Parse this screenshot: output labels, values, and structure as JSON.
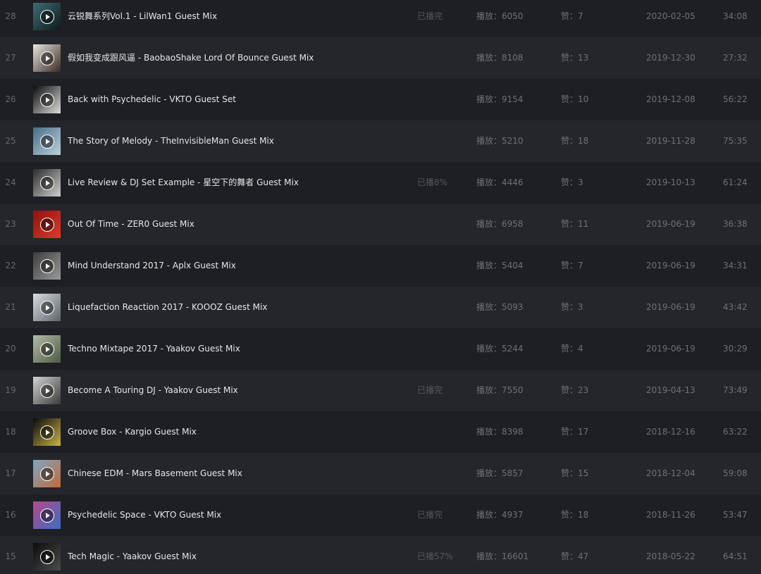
{
  "labels": {
    "plays_prefix": "播放：",
    "likes_prefix": "赞："
  },
  "tracks": [
    {
      "num": "28",
      "title": "云锐舞系列Vol.1 - LilWan1 Guest Mix",
      "progress": "已播完",
      "plays": "6050",
      "likes": "7",
      "date": "2020-02-05",
      "duration": "34:08",
      "cover": "#3f6d75",
      "cover2": "#0e1a1d"
    },
    {
      "num": "27",
      "title": "假如我变成跟风逼 - BaobaoShake Lord Of Bounce Guest Mix",
      "progress": "",
      "plays": "8108",
      "likes": "13",
      "date": "2019-12-30",
      "duration": "27:32",
      "cover": "#e9e6e1",
      "cover2": "#3a2a22"
    },
    {
      "num": "26",
      "title": "Back with Psychedelic - VKTO Guest Set",
      "progress": "",
      "plays": "9154",
      "likes": "10",
      "date": "2019-12-08",
      "duration": "56:22",
      "cover": "#0b0b0b",
      "cover2": "#dcdcdc"
    },
    {
      "num": "25",
      "title": "The Story of Melody - TheInvisibleMan Guest Mix",
      "progress": "",
      "plays": "5210",
      "likes": "18",
      "date": "2019-11-28",
      "duration": "75:35",
      "cover": "#4a6e86",
      "cover2": "#bcd0dd"
    },
    {
      "num": "24",
      "title": "Live Review & DJ Set Example - 星空下的舞者 Guest Mix",
      "progress": "已播8%",
      "plays": "4446",
      "likes": "3",
      "date": "2019-10-13",
      "duration": "61:24",
      "cover": "#2b2b2b",
      "cover2": "#cfcfcf"
    },
    {
      "num": "23",
      "title": "Out Of Time - ZER0 Guest Mix",
      "progress": "",
      "plays": "6958",
      "likes": "11",
      "date": "2019-06-19",
      "duration": "36:38",
      "cover": "#8e1111",
      "cover2": "#e03a2a"
    },
    {
      "num": "22",
      "title": "Mind Understand 2017 - Aplx Guest Mix",
      "progress": "",
      "plays": "5404",
      "likes": "7",
      "date": "2019-06-19",
      "duration": "34:31",
      "cover": "#3d3d3d",
      "cover2": "#9a9a9a"
    },
    {
      "num": "21",
      "title": "Liquefaction Reaction 2017 - KOOOZ Guest Mix",
      "progress": "",
      "plays": "5093",
      "likes": "3",
      "date": "2019-06-19",
      "duration": "43:42",
      "cover": "#d9dde0",
      "cover2": "#5d646a"
    },
    {
      "num": "20",
      "title": "Techno Mixtape 2017 - Yaakov Guest Mix",
      "progress": "",
      "plays": "5244",
      "likes": "4",
      "date": "2019-06-19",
      "duration": "30:29",
      "cover": "#b3bda5",
      "cover2": "#4f5a44"
    },
    {
      "num": "19",
      "title": "Become A Touring DJ - Yaakov Guest Mix",
      "progress": "已播完",
      "plays": "7550",
      "likes": "23",
      "date": "2019-04-13",
      "duration": "73:49",
      "cover": "#d4d4d4",
      "cover2": "#3a3a3a"
    },
    {
      "num": "18",
      "title": "Groove Box - Kargio Guest Mix",
      "progress": "",
      "plays": "8398",
      "likes": "17",
      "date": "2018-12-16",
      "duration": "63:22",
      "cover": "#0a0a0a",
      "cover2": "#c9b24a"
    },
    {
      "num": "17",
      "title": "Chinese EDM - Mars Basement Guest Mix",
      "progress": "",
      "plays": "5857",
      "likes": "15",
      "date": "2018-12-04",
      "duration": "59:08",
      "cover": "#7fa6c2",
      "cover2": "#c26a3a"
    },
    {
      "num": "16",
      "title": "Psychedelic Space - VKTO Guest Mix",
      "progress": "已播完",
      "plays": "4937",
      "likes": "18",
      "date": "2018-11-26",
      "duration": "53:47",
      "cover": "#b44a8d",
      "cover2": "#3d6cc0"
    },
    {
      "num": "15",
      "title": "Tech Magic - Yaakov Guest Mix",
      "progress": "已播57%",
      "plays": "16601",
      "likes": "47",
      "date": "2018-05-22",
      "duration": "64:51",
      "cover": "#0d0d0d",
      "cover2": "#4a4a4a"
    }
  ]
}
